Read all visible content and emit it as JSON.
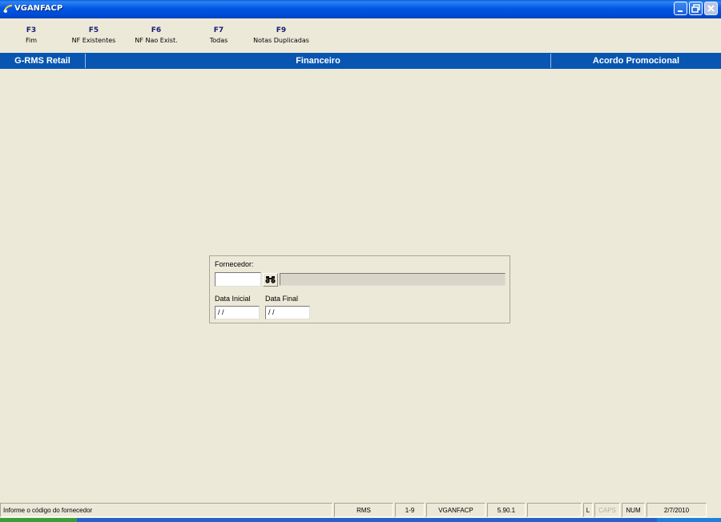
{
  "window": {
    "title": "VGANFACP",
    "icon": "app-logo-icon"
  },
  "toolbar": {
    "items": [
      {
        "key": "F3",
        "label": "Fim"
      },
      {
        "key": "F5",
        "label": "NF Existentes"
      },
      {
        "key": "F6",
        "label": "NF Nao Exist."
      },
      {
        "key": "F7",
        "label": "Todas"
      },
      {
        "key": "F9",
        "label": "Notas Duplicadas"
      }
    ]
  },
  "header": {
    "system": "G-RMS Retail",
    "module": "Financeiro",
    "screen": "Acordo Promocional",
    "color": "#0856b2"
  },
  "form": {
    "fornecedor_label": "Fornecedor:",
    "fornecedor_code": "",
    "fornecedor_name": "",
    "search_icon": "binoculars-icon",
    "data_inicial_label": "Data Inicial",
    "data_inicial_value": " / /",
    "data_final_label": "Data Final",
    "data_final_value": " / /"
  },
  "status": {
    "message": "Informe o código do fornecedor",
    "system": "RMS",
    "code": "1-9",
    "program": "VGANFACP",
    "version": "5.90.1",
    "blank": "",
    "lock": "L",
    "caps": "CAPS",
    "num": "NUM",
    "date": "2/7/2010"
  }
}
